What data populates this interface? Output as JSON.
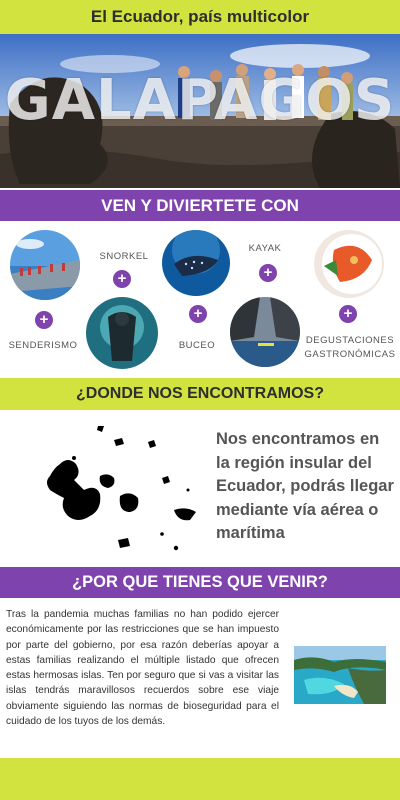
{
  "header": {
    "title": "El Ecuador, país multicolor"
  },
  "hero": {
    "word": "GALAPAGOS",
    "image": "galapagos-tourists-iguana-photo"
  },
  "activities": {
    "title": "VEN Y DIVIERTETE CON",
    "items": [
      {
        "label": "SENDERISMO",
        "image": "hiking-coast-photo"
      },
      {
        "label": "SNORKEL",
        "image": "snorkel-underwater-photo"
      },
      {
        "label": "BUCEO",
        "image": "whale-shark-diving-photo"
      },
      {
        "label": "KAYAK",
        "image": "kayak-cliffs-photo"
      },
      {
        "label": "DEGUSTACIONES GASTRONÓMICAS",
        "image": "shrimp-dish-photo"
      }
    ],
    "plus_symbol": "+"
  },
  "location": {
    "title": "¿DONDE NOS ENCONTRAMOS?",
    "text": "Nos encontramos en la región insular del Ecuador, podrás llegar mediante vía aérea o marítima",
    "map_icon": "galapagos-islands-map"
  },
  "reasons": {
    "title": "¿POR QUE TIENES QUE VENIR?",
    "text": "Tras la pandemia muchas familias no han podido ejercer económicamente por las restricciones que se han impuesto por parte del gobierno, por esa razón deberías apoyar a estas familias realizando el múltiple listado que ofrecen estas hermosas islas. Ten por seguro que si vas a visitar las islas tendrás maravillosos recuerdos sobre ese viaje obviamente siguiendo las normas de bioseguridad para el cuidado de los tuyos de los demás.",
    "image": "turquoise-bay-photo"
  },
  "colors": {
    "lime": "#d2e33f",
    "purple": "#7f43ad",
    "text_gray": "#555555"
  }
}
